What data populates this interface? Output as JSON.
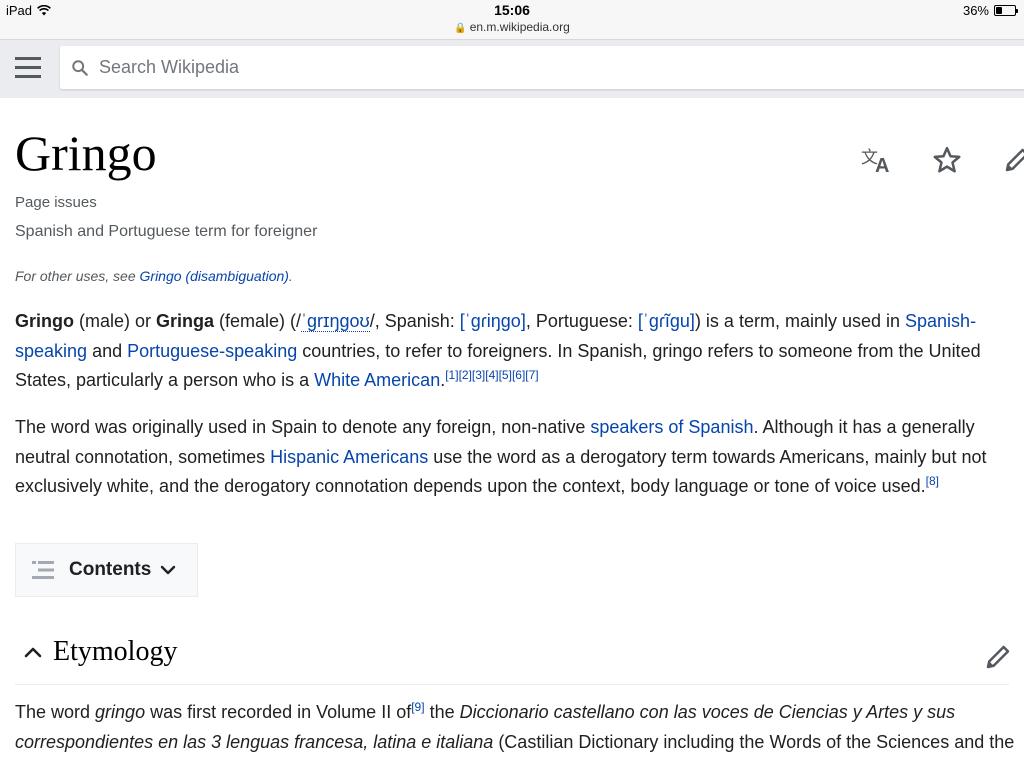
{
  "status_bar": {
    "device": "iPad",
    "time": "15:06",
    "url": "en.m.wikipedia.org",
    "battery": "36%",
    "battery_level": 0.36
  },
  "header": {
    "search_placeholder": "Search Wikipedia",
    "icons": [
      "menu-icon",
      "search-icon"
    ]
  },
  "article": {
    "title": "Gringo",
    "page_issues": "Page issues",
    "tagline": "Spanish and Portuguese term for foreigner",
    "action_icons": [
      "language-icon",
      "star-icon",
      "edit-icon"
    ],
    "hatnote": {
      "prefix": "For other uses, see ",
      "link": "Gringo (disambiguation)",
      "suffix": "."
    },
    "para1": {
      "t1": "Gringo",
      "t2": " (male) or ",
      "t3": "Gringa",
      "t4": " (female) (/",
      "ipa": "ˈɡrɪŋɡoʊ",
      "t5": "/, Spanish: ",
      "es_ipa": "[ˈɡɾiŋɡo]",
      "t6": ", Portuguese: ",
      "pt_ipa": "[ˈɡɾĩɡu]",
      "t7": ") is a term, mainly used in ",
      "link1": "Spanish-speaking",
      "t8": " and ",
      "link2": "Portuguese-speaking",
      "t9": " countries, to refer to foreigners. In Spanish, gringo refers to someone from the United States, particularly a person who is a ",
      "link3": "White American",
      "t10": ".",
      "refs": [
        "[1]",
        "[2]",
        "[3]",
        "[4]",
        "[5]",
        "[6]",
        "[7]"
      ]
    },
    "para2": {
      "t1": "The word was originally used in Spain to denote any foreign, non-native ",
      "link1": "speakers of Spanish",
      "t2": ". Although it has a generally neutral connotation, sometimes ",
      "link2": "Hispanic Americans",
      "t3": " use the word as a derogatory term towards Americans, mainly but not exclusively white, and the derogatory connotation depends upon the context, body language or tone of voice used.",
      "ref": "[8]"
    },
    "toc_label": "Contents",
    "section1": {
      "title": "Etymology",
      "p": {
        "t1": "The word ",
        "t2": "gringo",
        "t3": " was first recorded in Volume II of",
        "ref": "[9]",
        "t4": " the ",
        "t5": "Diccionario castellano con las voces de Ciencias y Artes y sus correspondientes en las 3 lenguas francesa, latina e italiana",
        "t6": " (Castilian Dictionary including the Words of the Sciences and the"
      }
    }
  }
}
